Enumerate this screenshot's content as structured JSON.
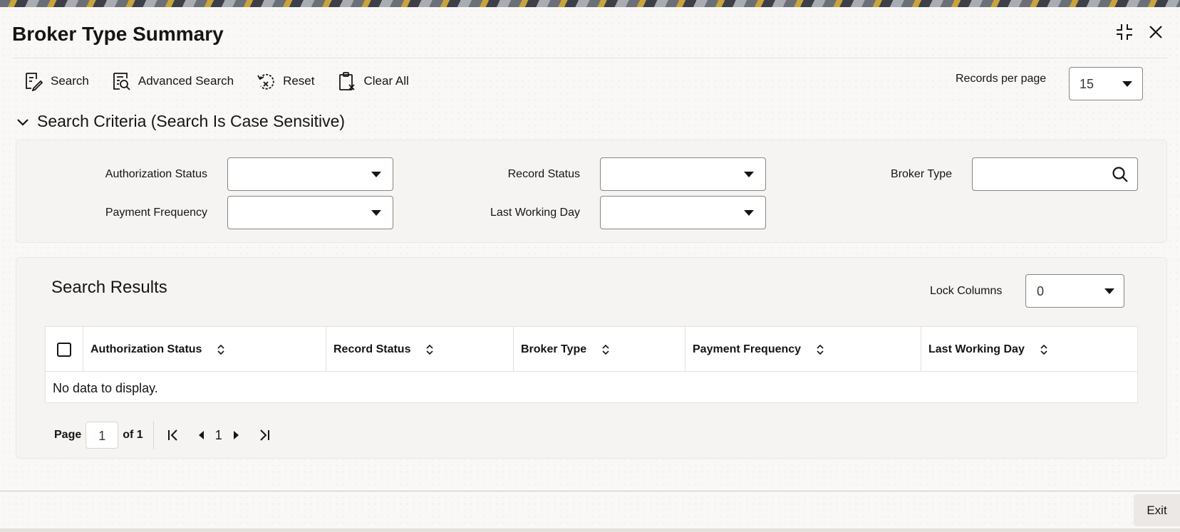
{
  "window": {
    "title": "Broker Type Summary"
  },
  "toolbar": {
    "search_label": "Search",
    "advanced_search_label": "Advanced Search",
    "reset_label": "Reset",
    "clear_all_label": "Clear All",
    "records_per_page_label": "Records per page",
    "records_per_page_value": "15"
  },
  "search_criteria": {
    "header": "Search Criteria (Search Is Case Sensitive)",
    "fields": {
      "authorization_status": {
        "label": "Authorization Status",
        "value": ""
      },
      "record_status": {
        "label": "Record Status",
        "value": ""
      },
      "broker_type": {
        "label": "Broker Type",
        "value": ""
      },
      "payment_frequency": {
        "label": "Payment Frequency",
        "value": ""
      },
      "last_working_day": {
        "label": "Last Working Day",
        "value": ""
      }
    }
  },
  "results": {
    "title": "Search Results",
    "lock_columns_label": "Lock Columns",
    "lock_columns_value": "0",
    "columns": [
      "Authorization Status",
      "Record Status",
      "Broker Type",
      "Payment Frequency",
      "Last Working Day"
    ],
    "empty_message": "No data to display."
  },
  "pager": {
    "page_label": "Page",
    "current_page": "1",
    "of_label": "of 1",
    "page_number": "1"
  },
  "footer": {
    "exit_label": "Exit"
  }
}
